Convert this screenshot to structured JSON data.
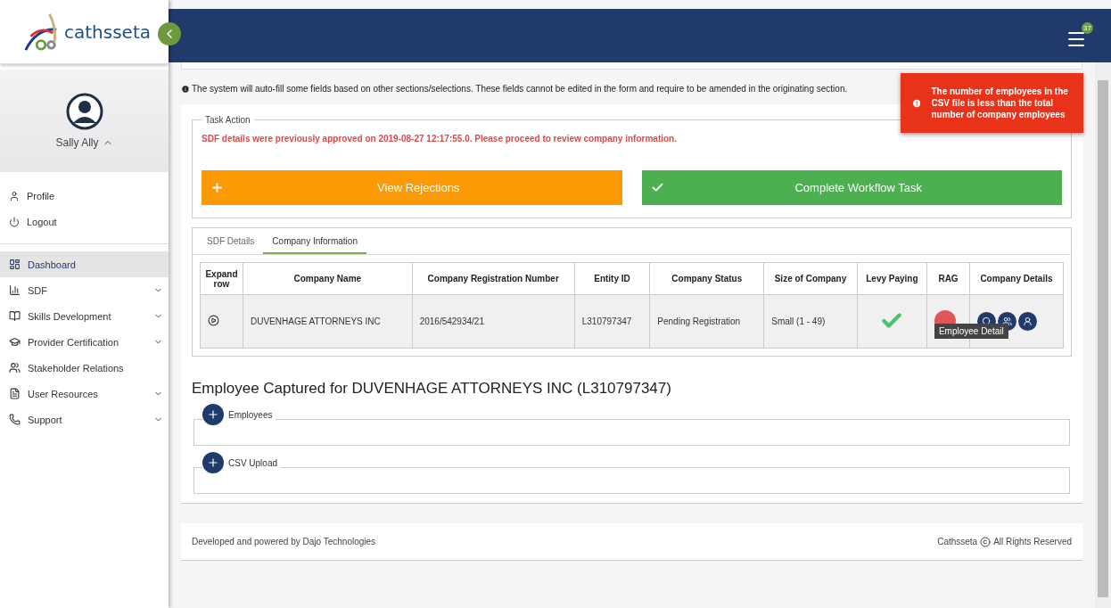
{
  "brand": {
    "name": "cathsseta"
  },
  "header": {
    "notification_count": "37"
  },
  "user": {
    "name": "Sally Ally",
    "expanded": true
  },
  "account_menu": [
    {
      "label": "Profile"
    },
    {
      "label": "Logout"
    }
  ],
  "nav": [
    {
      "label": "Dashboard",
      "selected": true,
      "has_children": false
    },
    {
      "label": "SDF",
      "selected": false,
      "has_children": true
    },
    {
      "label": "Skills Development",
      "selected": false,
      "has_children": true
    },
    {
      "label": "Provider Certification",
      "selected": false,
      "has_children": true
    },
    {
      "label": "Stakeholder Relations",
      "selected": false,
      "has_children": false
    },
    {
      "label": "User Resources",
      "selected": false,
      "has_children": true
    },
    {
      "label": "Support",
      "selected": false,
      "has_children": true
    }
  ],
  "info_note": "The system will auto-fill some fields based on other sections/selections. These fields cannot be edited in the form and require to be amended in the originating section.",
  "task_action": {
    "legend": "Task Action",
    "message": "SDF details were previously approved on 2019-08-27 12:17:55.0. Please proceed to review company information.",
    "buttons": [
      {
        "label": "View Rejections",
        "kind": "warning"
      },
      {
        "label": "Complete Workflow Task",
        "kind": "success"
      }
    ]
  },
  "tabs": [
    {
      "label": "SDF Details",
      "selected": false
    },
    {
      "label": "Company Information",
      "selected": true
    }
  ],
  "table": {
    "columns": [
      "Expand row",
      "Company Name",
      "Company Registration Number",
      "Entity ID",
      "Company Status",
      "Size of Company",
      "Levy Paying",
      "RAG",
      "Company Details"
    ],
    "rows": [
      {
        "company_name": "DUVENHAGE ATTORNEYS INC",
        "registration_number": "2016/542934/21",
        "entity_id": "L310797347",
        "status": "Pending Registration",
        "size": "Small (1 - 49)",
        "levy_paying": true,
        "rag": {
          "color": "#e05555"
        }
      }
    ]
  },
  "tooltip": "Employee Detail",
  "employee_section": {
    "title": "Employee Captured for DUVENHAGE ATTORNEYS INC (L310797347)",
    "panels": [
      {
        "label": "Employees"
      },
      {
        "label": "CSV Upload"
      }
    ]
  },
  "footer": {
    "left": "Developed and powered by Dajo Technologies",
    "brand": "Cathsseta",
    "rights": "All Rights Reserved"
  },
  "toast": {
    "message": "The number of employees in the CSV file is less than the total number of company employees"
  }
}
